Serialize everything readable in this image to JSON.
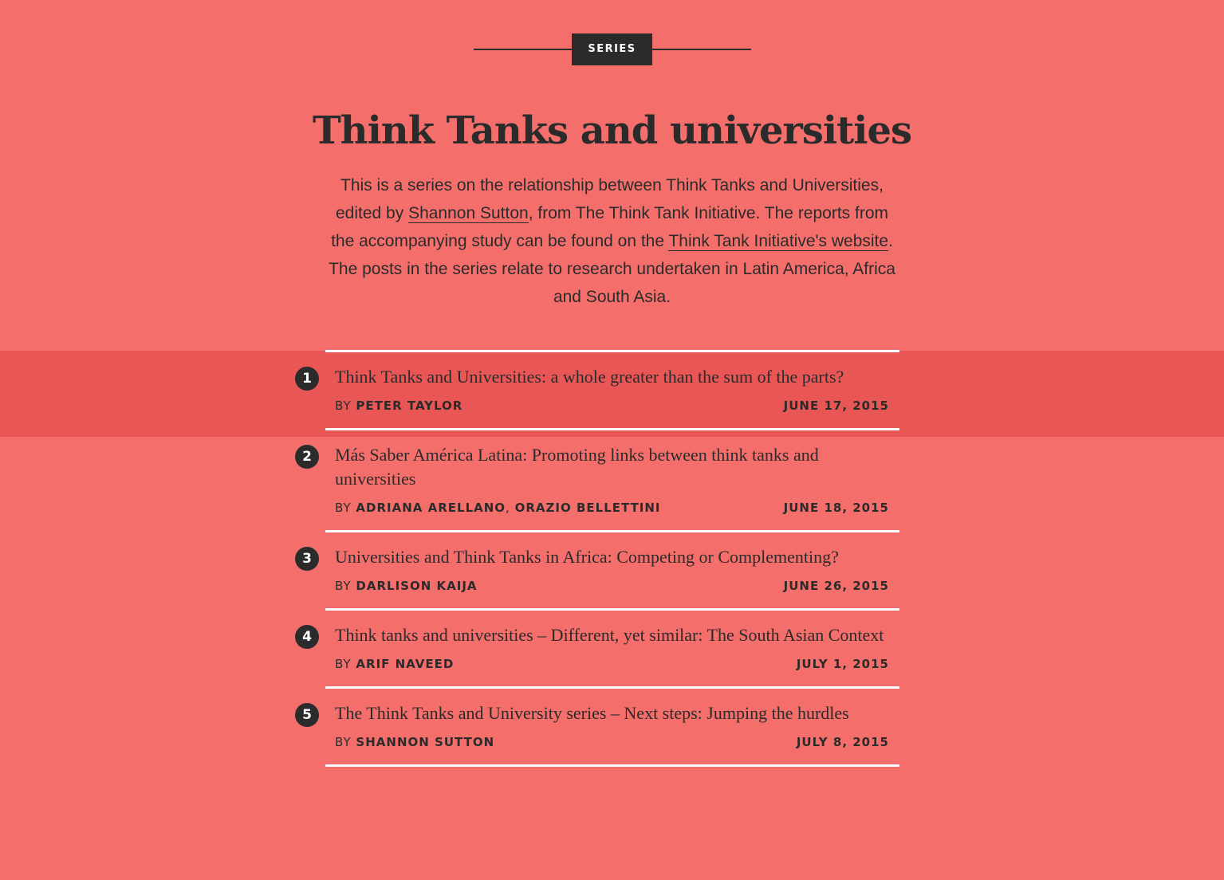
{
  "series_label": "SERIES",
  "title": "Think Tanks and universities",
  "intro": {
    "text_1": "This is a series on the relationship between Think Tanks and Universities, edited by ",
    "link_1": "Shannon Sutton",
    "text_2": ", from The Think Tank Initiative. The reports from the accompanying study can be found on the ",
    "link_2": "Think Tank Initiative's website",
    "text_3": ". The posts in the series relate to research undertaken in Latin America, Africa and South Asia."
  },
  "by_label": "BY",
  "posts": [
    {
      "number": "1",
      "title": "Think Tanks and Universities: a whole greater than the sum of the parts?",
      "authors": [
        "PETER TAYLOR"
      ],
      "date": "JUNE 17, 2015"
    },
    {
      "number": "2",
      "title": "Más Saber América Latina: Promoting links between think tanks and universities",
      "authors": [
        "ADRIANA ARELLANO",
        "ORAZIO BELLETTINI"
      ],
      "author_separator": ",",
      "date": "JUNE 18, 2015"
    },
    {
      "number": "3",
      "title": "Universities and Think Tanks in Africa: Competing or Complementing?",
      "authors": [
        "DARLISON KAIJA"
      ],
      "date": "JUNE 26, 2015"
    },
    {
      "number": "4",
      "title": "Think tanks and universities – Different, yet similar: The South Asian Context",
      "authors": [
        "ARIF NAVEED"
      ],
      "date": "JULY 1, 2015"
    },
    {
      "number": "5",
      "title": "The Think Tanks and University series – Next steps: Jumping the hurdles",
      "authors": [
        "SHANNON SUTTON"
      ],
      "date": "JULY 8, 2015"
    }
  ],
  "colors": {
    "background": "#f46f6b",
    "highlight": "#e95656",
    "text": "#2b2b2b",
    "rule": "#ffffff"
  }
}
